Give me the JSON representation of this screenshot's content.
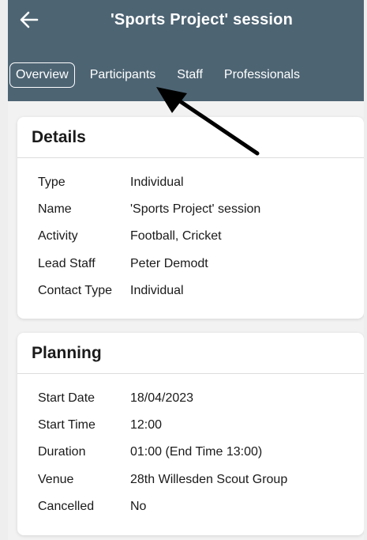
{
  "header": {
    "title": "'Sports Project' session",
    "back_icon": "arrow-left-icon"
  },
  "tabs": [
    {
      "label": "Overview",
      "active": true
    },
    {
      "label": "Participants",
      "active": false
    },
    {
      "label": "Staff",
      "active": false
    },
    {
      "label": "Professionals",
      "active": false
    }
  ],
  "details": {
    "title": "Details",
    "rows": [
      {
        "key": "Type",
        "value": "Individual"
      },
      {
        "key": "Name",
        "value": "'Sports Project' session"
      },
      {
        "key": "Activity",
        "value": "Football, Cricket"
      },
      {
        "key": "Lead Staff",
        "value": "Peter Demodt"
      },
      {
        "key": "Contact Type",
        "value": "Individual"
      }
    ]
  },
  "planning": {
    "title": "Planning",
    "rows": [
      {
        "key": "Start Date",
        "value": "18/04/2023"
      },
      {
        "key": "Start Time",
        "value": "12:00"
      },
      {
        "key": "Duration",
        "value": "01:00 (End Time 13:00)"
      },
      {
        "key": "Venue",
        "value": "28th Willesden Scout Group"
      },
      {
        "key": "Cancelled",
        "value": "No"
      }
    ]
  },
  "colors": {
    "header_bg": "#4d6473",
    "page_bg": "#f2f2f2",
    "annotation_arrow": "#000000"
  }
}
